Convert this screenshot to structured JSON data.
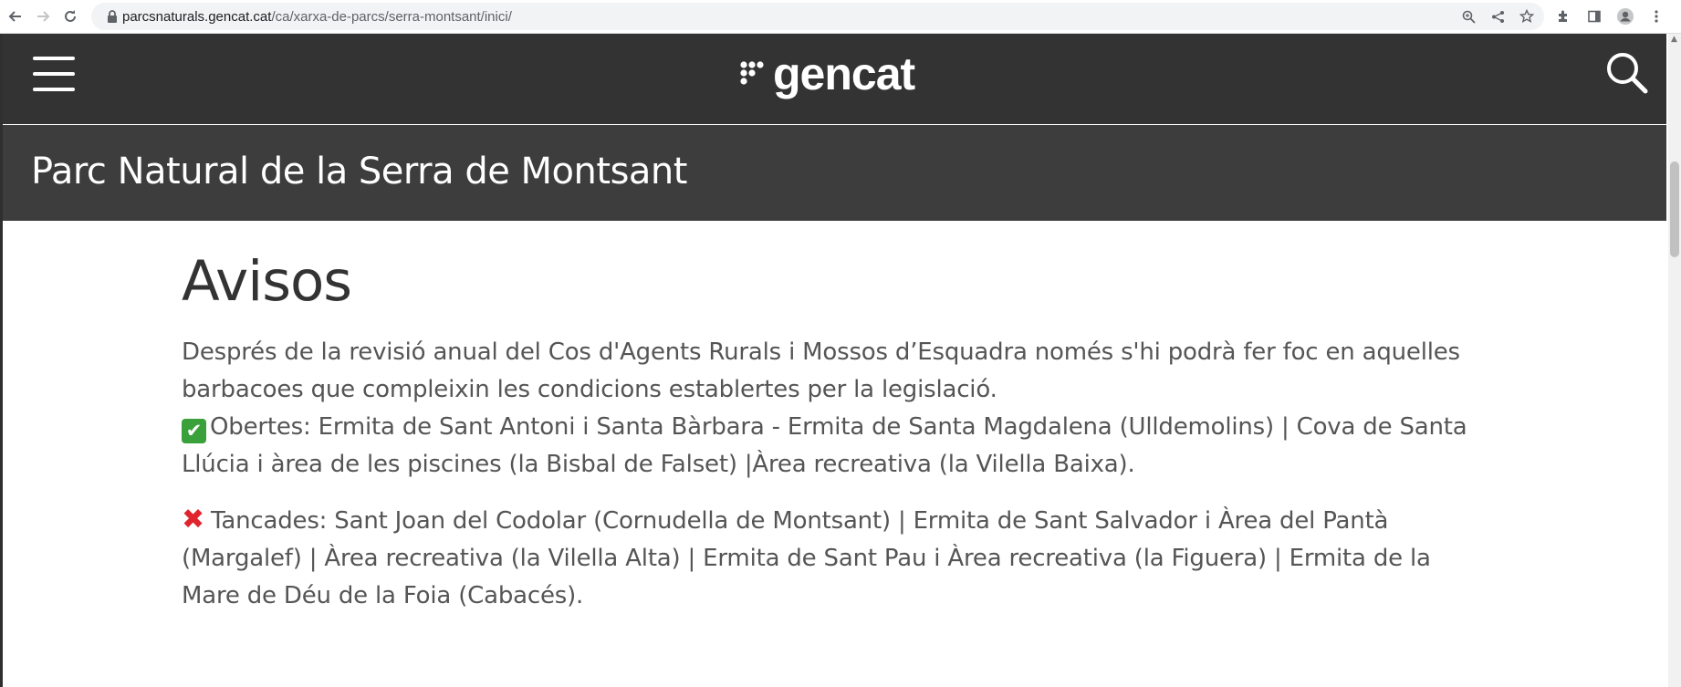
{
  "browser": {
    "url_host": "parcsnaturals.gencat.cat",
    "url_path": "/ca/xarxa-de-parcs/serra-montsant/inici/",
    "icons": [
      "back-icon",
      "forward-icon",
      "reload-icon",
      "lock-icon",
      "zoom-icon",
      "share-icon",
      "bookmark-star-icon",
      "extensions-icon",
      "side-panel-icon",
      "profile-icon",
      "kebab-menu-icon"
    ]
  },
  "header": {
    "logo_text": "gencat",
    "menu_icon": "hamburger-menu-icon",
    "search_icon": "search-icon"
  },
  "park": {
    "title": "Parc Natural de la Serra de Montsant"
  },
  "notices": {
    "heading": "Avisos",
    "intro": "Després de la revisió anual del Cos d'Agents Rurals i Mossos d’Esquadra només s'hi podrà fer foc en aquelles barbacoes que compleixin les condicions establertes per la legislació.",
    "open_emoji": "✔",
    "open_text": "Obertes: Ermita de Sant Antoni i Santa Bàrbara - Ermita de Santa Magdalena (Ulldemolins) | Cova de Santa Llúcia i àrea de les piscines (la Bisbal de Falset) |Àrea recreativa (la Vilella Baixa).",
    "closed_emoji": "✖",
    "closed_text": "Tancades: Sant Joan del Codolar (Cornudella de Montsant) | Ermita de Sant Salvador i Àrea del Pantà (Margalef) | Àrea recreativa (la Vilella Alta) | Ermita de Sant Pau i Àrea recreativa (la Figuera) | Ermita de la Mare de Déu de la Foia (Cabacés)."
  },
  "colors": {
    "topbar": "#333333",
    "titlebar": "#3d3d3d",
    "body_text": "#555555",
    "heading_text": "#333333",
    "check_green": "#3aa03a",
    "cross_red": "#e0242e"
  }
}
